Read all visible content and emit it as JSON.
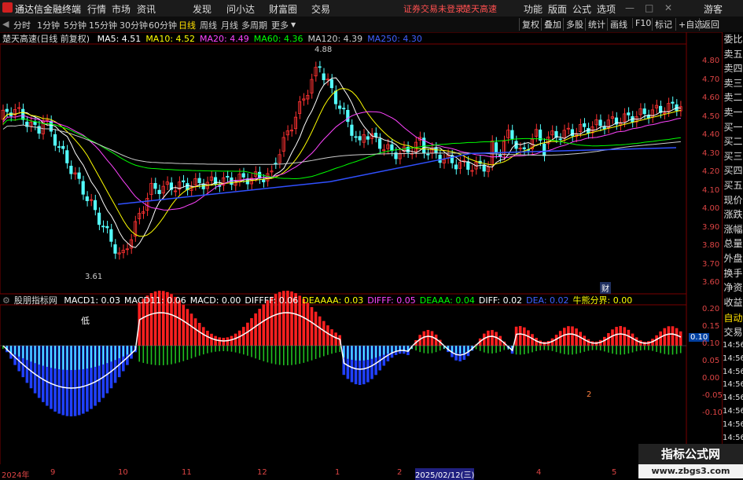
{
  "titlebar": {
    "app_name": "通达信金融终端",
    "menu": [
      "行情",
      "市场",
      "资讯",
      "发现",
      "问小达",
      "财富圈",
      "交易"
    ],
    "login_notice": "证券交易未登录",
    "stock_name": "楚天高速",
    "right_menu": [
      "功能",
      "版面",
      "公式",
      "选项"
    ],
    "user": "游客"
  },
  "toolbar": {
    "periods": [
      "分时",
      "1分钟",
      "5分钟",
      "15分钟",
      "30分钟",
      "60分钟",
      "日线",
      "周线",
      "月线",
      "多周期",
      "更多"
    ],
    "active_period": "日线",
    "right_buttons": [
      "复权",
      "叠加",
      "多股",
      "统计",
      "画线",
      "F10",
      "标记",
      "+自选",
      "返回"
    ]
  },
  "price_panel": {
    "title": "楚天高速(日线 前复权)",
    "ma": [
      {
        "label": "MA5: 4.51",
        "color": "#ffffff"
      },
      {
        "label": "MA10: 4.52",
        "color": "#ffff00"
      },
      {
        "label": "MA20: 4.49",
        "color": "#ff44ff"
      },
      {
        "label": "MA60: 4.36",
        "color": "#00ff00"
      },
      {
        "label": "MA120: 4.39",
        "color": "#cccccc"
      },
      {
        "label": "MA250: 4.30",
        "color": "#4060ff"
      }
    ],
    "high_label": "4.88",
    "low_label": "3.61",
    "axis": [
      "4.80",
      "4.70",
      "4.60",
      "4.50",
      "4.40",
      "4.30",
      "4.20",
      "4.10",
      "4.00",
      "3.90",
      "3.80",
      "3.70",
      "3.60"
    ],
    "marker": "财"
  },
  "indicator_panel": {
    "title": "股朋指标网",
    "items": [
      {
        "label": "MACD1: 0.03",
        "color": "#ffffff"
      },
      {
        "label": "MACD11: 0.06",
        "color": "#ffffff"
      },
      {
        "label": "MACD: 0.00",
        "color": "#ffffff"
      },
      {
        "label": "DIFFFF: 0.06",
        "color": "#ffffff"
      },
      {
        "label": "DEAAAA: 0.03",
        "color": "#ffff00"
      },
      {
        "label": "DIFFF: 0.05",
        "color": "#ff44ff"
      },
      {
        "label": "DEAAA: 0.04",
        "color": "#00ff00"
      },
      {
        "label": "DIFF: 0.02",
        "color": "#ffffff"
      },
      {
        "label": "DEA: 0.02",
        "color": "#4060ff"
      },
      {
        "label": "牛熊分界: 0.00",
        "color": "#ffff00"
      }
    ],
    "low_text": "低",
    "axis": [
      "0.20",
      "0.15",
      "0.10",
      "0.05",
      "0.00",
      "-0.05",
      "-0.10"
    ],
    "current_value": "0.10",
    "marker_2a": "2",
    "marker_2b": "2"
  },
  "date_axis": {
    "labels": [
      "2024年",
      "9",
      "10",
      "11",
      "12",
      "1",
      "2",
      "2025/02/12(三)",
      "4",
      "5"
    ]
  },
  "right_panel": {
    "items": [
      "委比",
      "卖五",
      "卖四",
      "卖三",
      "卖二",
      "卖一",
      "买一",
      "买二",
      "买三",
      "买四",
      "买五",
      "现价",
      "涨跌",
      "涨幅",
      "总量",
      "外盘",
      "换手",
      "净资",
      "收益"
    ],
    "lower": [
      "自动",
      "交易"
    ],
    "times": [
      "14:56",
      "14:56",
      "14:56",
      "14:56",
      "14:56",
      "14:56",
      "14:56",
      "14:56",
      "14:56"
    ]
  },
  "watermark": {
    "title": "指标公式网",
    "url": "www.zbgs3.com"
  },
  "colors": {
    "up": "#ff3232",
    "down": "#54ffff",
    "grid": "#7a0000"
  }
}
